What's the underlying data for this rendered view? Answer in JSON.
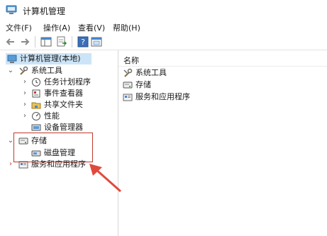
{
  "window": {
    "title": "计算机管理"
  },
  "menu": [
    {
      "label": "文件(F)"
    },
    {
      "label": "操作(A)"
    },
    {
      "label": "查看(V)"
    },
    {
      "label": "帮助(H)"
    }
  ],
  "toolbar": {
    "buttons": [
      "back-arrow-icon",
      "forward-arrow-icon",
      "show-hide-tree-icon",
      "export-list-icon",
      "help-icon",
      "properties-icon"
    ]
  },
  "tree": {
    "root": "计算机管理(本地)",
    "system_tools": "系统工具",
    "task_scheduler": "任务计划程序",
    "event_viewer": "事件查看器",
    "shared_folders": "共享文件夹",
    "performance": "性能",
    "device_manager": "设备管理器",
    "storage": "存储",
    "disk_management": "磁盘管理",
    "services_apps": "服务和应用程序"
  },
  "list": {
    "column_name": "名称",
    "items": [
      "系统工具",
      "存储",
      "服务和应用程序"
    ]
  },
  "colors": {
    "selection": "#cce4f7",
    "annotation": "#c0392b"
  }
}
